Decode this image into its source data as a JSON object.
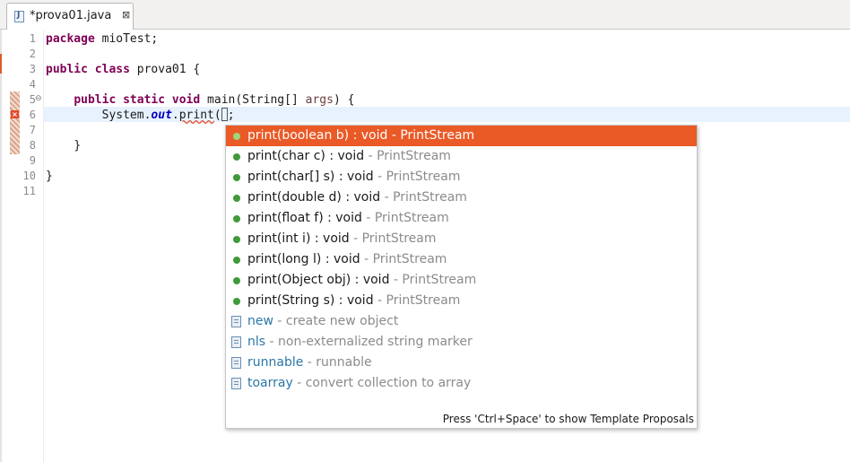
{
  "tab": {
    "title": "*prova01.java",
    "close_glyph": "⊠",
    "icon": "java-file-icon"
  },
  "editor": {
    "line_numbers": [
      "1",
      "2",
      "3",
      "4",
      "5",
      "6",
      "7",
      "8",
      "9",
      "10",
      "11"
    ],
    "lines": {
      "l1_kw": "package",
      "l1_rest": " mioTest;",
      "l3_kw1": "public",
      "l3_kw2": "class",
      "l3_rest": " prova01 {",
      "l5_kw1": "public",
      "l5_kw2": "static",
      "l5_kw3": "void",
      "l5_mid": " main(String[] ",
      "l5_param": "args",
      "l5_end": ") {",
      "l6_start": "System.",
      "l6_field": "out",
      "l6_dot": ".",
      "l6_method": "print",
      "l6_paren": "(",
      "l6_end": ";",
      "l8": "}",
      "l10": "}"
    },
    "fold_glyph": "⊖",
    "error_marker": "×"
  },
  "completion": {
    "items": [
      {
        "sig": "print(boolean b) : void",
        "qual": " - PrintStream",
        "selected": true
      },
      {
        "sig": "print(char c) : void",
        "qual": " - PrintStream"
      },
      {
        "sig": "print(char[] s) : void",
        "qual": " - PrintStream"
      },
      {
        "sig": "print(double d) : void",
        "qual": " - PrintStream"
      },
      {
        "sig": "print(float f) : void",
        "qual": " - PrintStream"
      },
      {
        "sig": "print(int i) : void",
        "qual": " - PrintStream"
      },
      {
        "sig": "print(long l) : void",
        "qual": " - PrintStream"
      },
      {
        "sig": "print(Object obj) : void",
        "qual": " - PrintStream"
      },
      {
        "sig": "print(String s) : void",
        "qual": " - PrintStream"
      }
    ],
    "templates": [
      {
        "name": "new",
        "desc": " - create new object"
      },
      {
        "name": "nls",
        "desc": " - non-externalized string marker"
      },
      {
        "name": "runnable",
        "desc": " - runnable"
      },
      {
        "name": "toarray",
        "desc": " - convert collection to array"
      }
    ],
    "footer": "Press 'Ctrl+Space' to show Template Proposals"
  },
  "colors": {
    "selection": "#ea5a26",
    "keyword": "#7f0055",
    "method_dot": "#3f9a3a",
    "template_name": "#2a77a8"
  }
}
